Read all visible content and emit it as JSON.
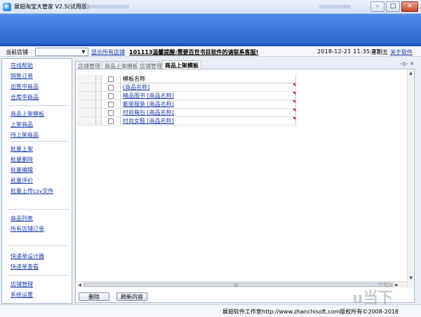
{
  "window": {
    "title": "展翅淘宝大管家 V2.5(试用版)",
    "buttons": [
      "–",
      "□",
      "✕"
    ]
  },
  "toolbar": {
    "store_label": "当前店铺",
    "store_value": "",
    "show_all_stores": "显示所有店铺",
    "notice": "101113温馨提醒:需要百世书目软件的请联系客服!",
    "datetime": "2018-12-21  11:35:37",
    "weekday": "星期五",
    "about": "关于软件"
  },
  "sidebar": {
    "group1": [
      "在线帮助",
      "销售订单",
      "出售中商品",
      "仓库中商品"
    ],
    "group2": [
      "商品上架模板",
      "上架商品",
      "待上架商品"
    ],
    "group3": [
      "批量上架",
      "批量删除",
      "批量编辑",
      "批量评价",
      "批量上传csv文件"
    ],
    "group4": [
      "商品列表",
      "所有店铺订单"
    ],
    "group5": [
      "快递单设计器",
      "快递单查看"
    ],
    "group6": [
      "店铺管理",
      "系统设置"
    ]
  },
  "tabs": [
    "店铺管理",
    "商品上架模板",
    "店铺管理",
    "商品上架模板"
  ],
  "tab_nav": [
    "◁",
    "▷",
    "✕"
  ],
  "grid": {
    "header": "模板名称",
    "rows": [
      "[商品名称]",
      "精品图书 [商品名称]",
      "靓丽服装 [商品名称]",
      "时尚箱包 [商品名称]",
      "时尚女鞋 [商品名称]"
    ]
  },
  "buttons": {
    "delete": "删除",
    "refresh": "刷新内容"
  },
  "status": {
    "text": "展翅软件工作室http://www.zhanchisoft.com版权所有©2008-2018"
  },
  "watermark": {
    "text": "u当下",
    "sub": "下载站"
  }
}
